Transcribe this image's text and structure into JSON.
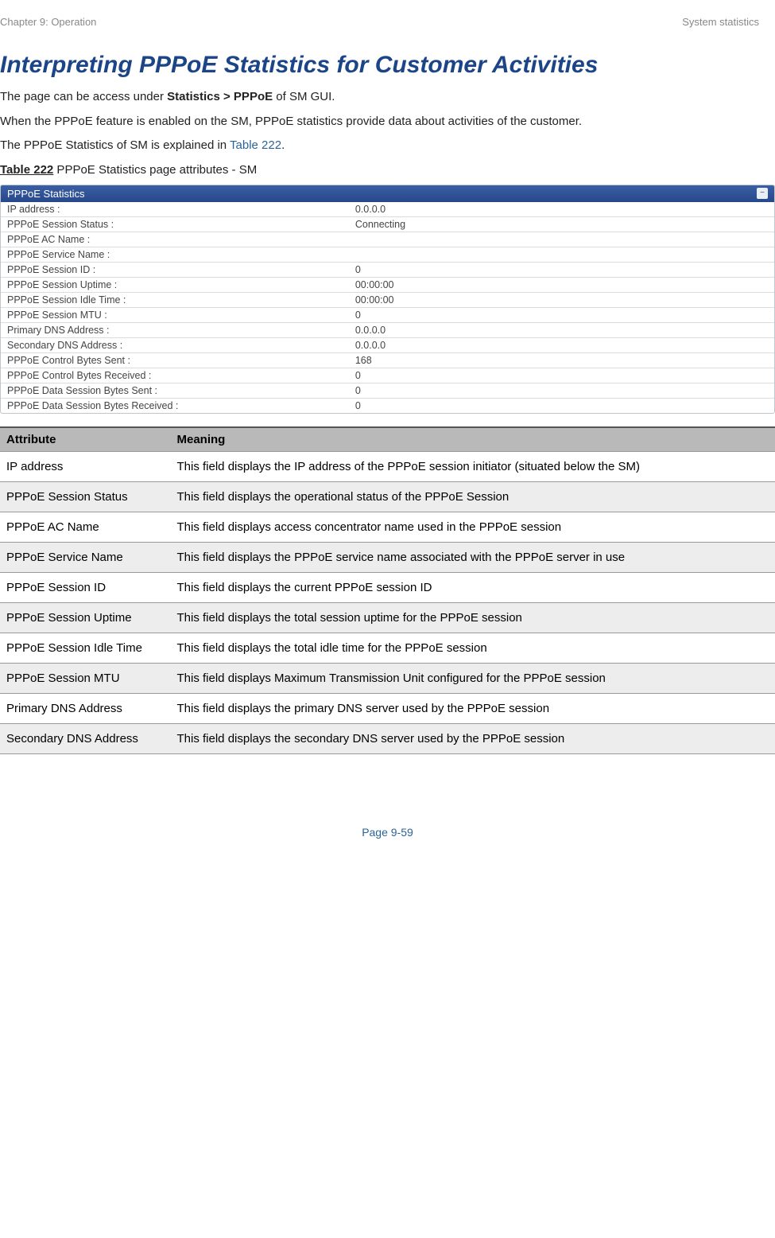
{
  "header": {
    "left": "Chapter 9:  Operation",
    "right": "System statistics"
  },
  "heading": "Interpreting PPPoE Statistics for Customer Activities",
  "intro": {
    "line1_pre": "The page can be access under ",
    "line1_bold": "Statistics > PPPoE",
    "line1_post": " of SM GUI.",
    "line2": "When the PPPoE feature is enabled on the SM, PPPoE statistics provide data about activities of the customer.",
    "line3_pre": "The PPPoE Statistics of SM is explained in ",
    "line3_link": "Table 222",
    "line3_post": "."
  },
  "table_caption": {
    "label": "Table 222",
    "text": " PPPoE Statistics page attributes - SM"
  },
  "panel": {
    "title": "PPPoE Statistics",
    "rows": [
      {
        "label": "IP address :",
        "value": "0.0.0.0"
      },
      {
        "label": "PPPoE Session Status :",
        "value": "Connecting"
      },
      {
        "label": "PPPoE AC Name :",
        "value": ""
      },
      {
        "label": "PPPoE Service Name :",
        "value": ""
      },
      {
        "label": "PPPoE Session ID :",
        "value": "0"
      },
      {
        "label": "PPPoE Session Uptime :",
        "value": "00:00:00"
      },
      {
        "label": "PPPoE Session Idle Time :",
        "value": "00:00:00"
      },
      {
        "label": "PPPoE Session MTU :",
        "value": "0"
      },
      {
        "label": "Primary DNS Address :",
        "value": "0.0.0.0"
      },
      {
        "label": "Secondary DNS Address :",
        "value": "0.0.0.0"
      },
      {
        "label": "PPPoE Control Bytes Sent :",
        "value": "168"
      },
      {
        "label": "PPPoE Control Bytes Received :",
        "value": "0"
      },
      {
        "label": "PPPoE Data Session Bytes Sent :",
        "value": "0"
      },
      {
        "label": "PPPoE Data Session Bytes Received :",
        "value": "0"
      }
    ]
  },
  "attr_table": {
    "head": {
      "col1": "Attribute",
      "col2": "Meaning"
    },
    "rows": [
      {
        "attr": "IP address",
        "meaning": "This field displays the IP address of the PPPoE session initiator (situated below the SM)"
      },
      {
        "attr": "PPPoE Session Status",
        "meaning": "This field displays the operational status of the PPPoE Session"
      },
      {
        "attr": "PPPoE AC Name",
        "meaning": "This field displays access concentrator name used in the PPPoE session"
      },
      {
        "attr": "PPPoE Service Name",
        "meaning": "This field displays the PPPoE service name associated with the PPPoE server in use"
      },
      {
        "attr": "PPPoE Session ID",
        "meaning": "This field displays the current PPPoE session ID"
      },
      {
        "attr": "PPPoE Session Uptime",
        "meaning": "This field displays the total session uptime for the PPPoE session"
      },
      {
        "attr": "PPPoE Session Idle Time",
        "meaning": "This field displays the total idle time for the PPPoE session"
      },
      {
        "attr": "PPPoE Session MTU",
        "meaning": "This field displays Maximum Transmission Unit configured for the PPPoE session"
      },
      {
        "attr": "Primary DNS Address",
        "meaning": "This field displays the primary DNS server used by the PPPoE session"
      },
      {
        "attr": "Secondary DNS Address",
        "meaning": "This field displays the secondary DNS server used by the PPPoE session"
      }
    ]
  },
  "footer": "Page 9-59"
}
